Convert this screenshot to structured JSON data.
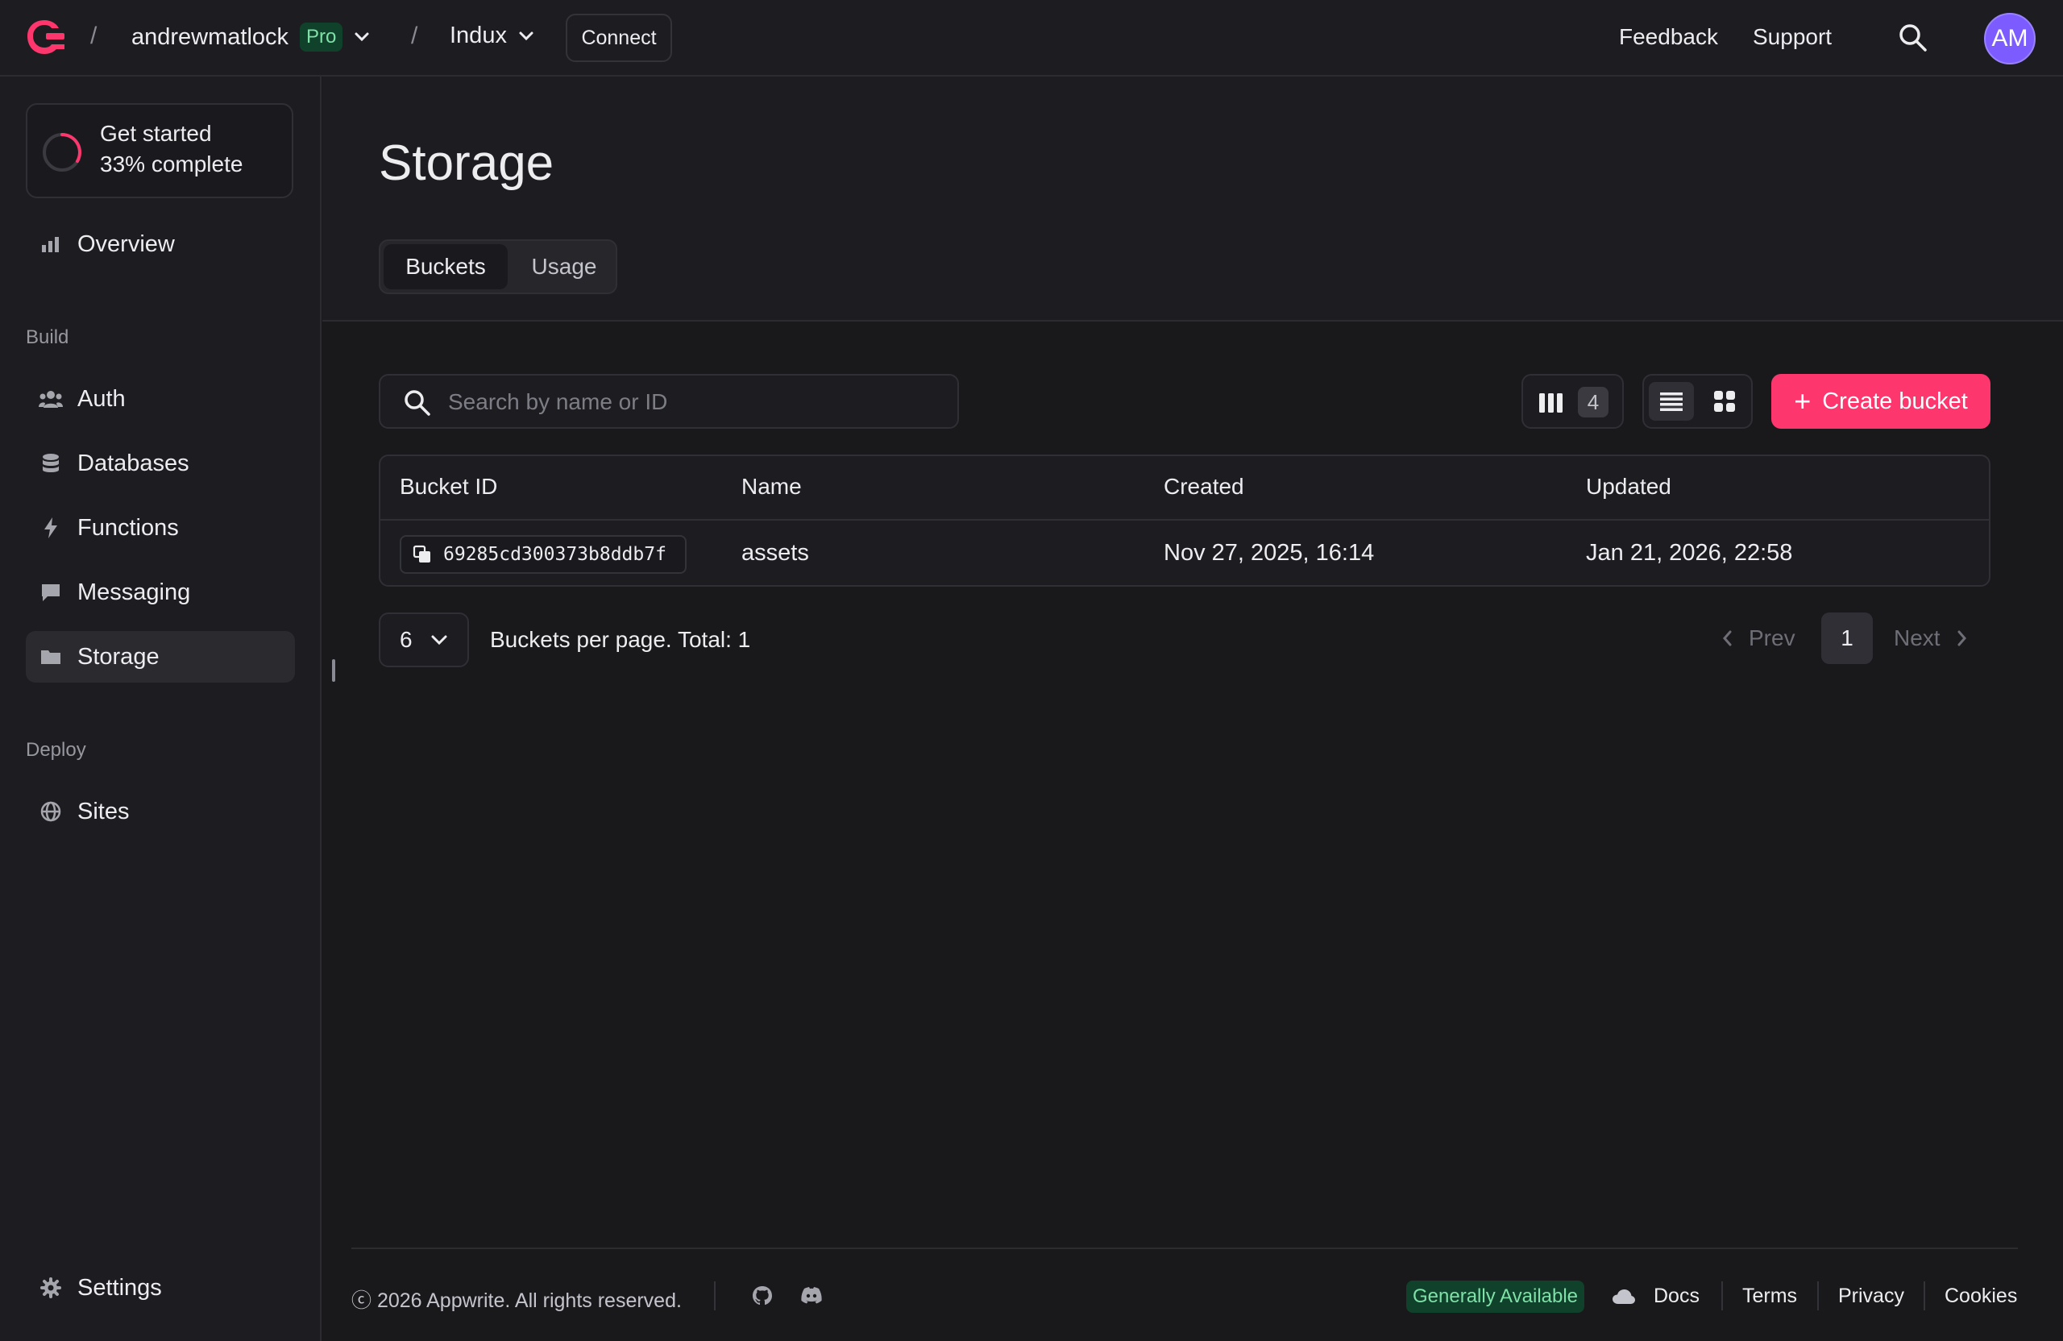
{
  "topbar": {
    "org": "andrewmatlock",
    "plan_badge": "Pro",
    "project": "Indux",
    "connect_label": "Connect",
    "feedback_label": "Feedback",
    "support_label": "Support",
    "avatar_initials": "AM",
    "separator": "/"
  },
  "sidebar": {
    "get_started": {
      "title": "Get started",
      "progress_text": "33% complete",
      "progress": 0.33
    },
    "overview_label": "Overview",
    "build_section": "Build",
    "build_items": [
      {
        "label": "Auth",
        "icon": "users-icon"
      },
      {
        "label": "Databases",
        "icon": "database-icon"
      },
      {
        "label": "Functions",
        "icon": "lightning-icon"
      },
      {
        "label": "Messaging",
        "icon": "chat-icon"
      },
      {
        "label": "Storage",
        "icon": "folder-icon",
        "active": true
      }
    ],
    "deploy_section": "Deploy",
    "deploy_items": [
      {
        "label": "Sites",
        "icon": "globe-icon"
      }
    ],
    "settings_label": "Settings"
  },
  "main": {
    "title": "Storage",
    "tabs": [
      {
        "label": "Buckets",
        "active": true
      },
      {
        "label": "Usage",
        "active": false
      }
    ],
    "search_placeholder": "Search by name or ID",
    "visible_columns_count": "4",
    "create_button_label": "Create bucket",
    "table": {
      "headers": [
        "Bucket ID",
        "Name",
        "Created",
        "Updated"
      ],
      "rows": [
        {
          "id": "69285cd300373b8ddb7f",
          "name": "assets",
          "created": "Nov 27, 2025, 16:14",
          "updated": "Jan 21, 2026, 22:58"
        }
      ]
    },
    "pagination": {
      "per_page": "6",
      "summary": "Buckets per page. Total: 1",
      "prev_label": "Prev",
      "current_page": "1",
      "next_label": "Next"
    }
  },
  "footer": {
    "copyright": "ⓒ 2026 Appwrite. All rights reserved.",
    "status_badge": "Generally Available",
    "links": [
      "Docs",
      "Terms",
      "Privacy",
      "Cookies"
    ]
  },
  "colors": {
    "brand": "#fd366e",
    "background": "#19191c",
    "surface": "#1d1d21",
    "avatar": "#7c5cff",
    "badge_green_bg": "#10412a",
    "badge_green_text": "#7fe0a8"
  }
}
